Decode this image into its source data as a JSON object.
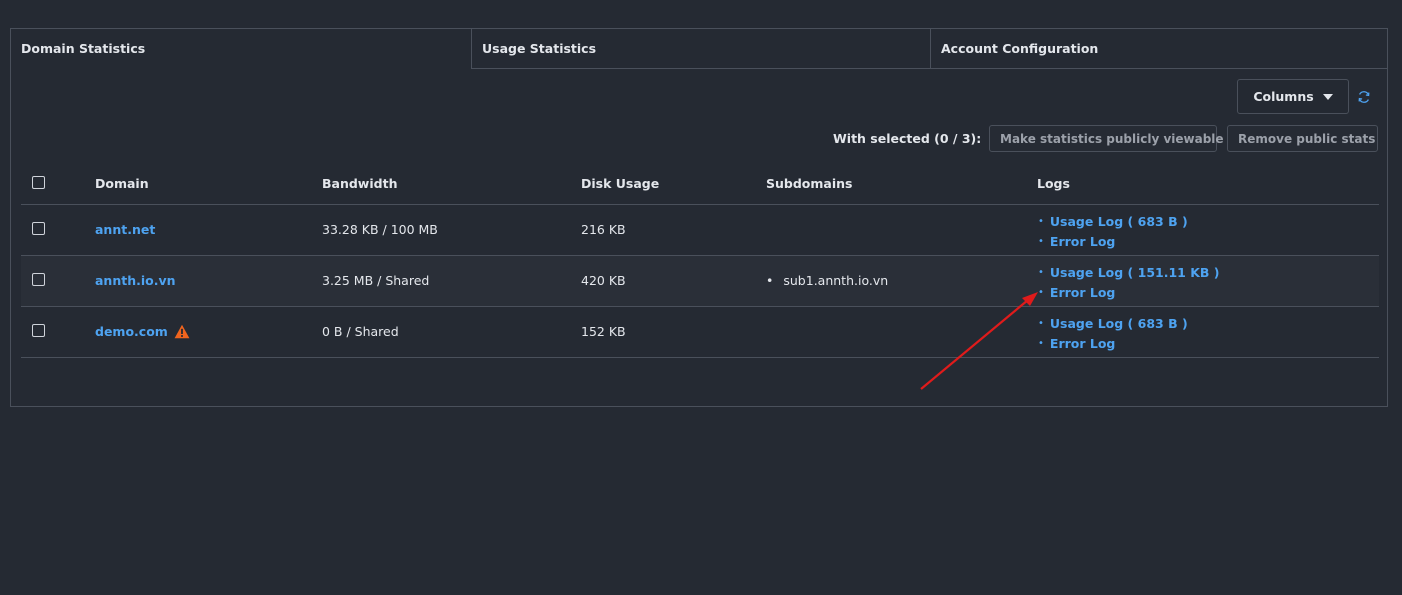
{
  "tabs": [
    {
      "label": "Domain Statistics",
      "active": true
    },
    {
      "label": "Usage Statistics",
      "active": false
    },
    {
      "label": "Account Configuration",
      "active": false
    }
  ],
  "toolbar": {
    "columns_label": "Columns",
    "with_selected": "With selected (0 / 3):",
    "make_public_label": "Make statistics publicly viewable",
    "remove_public_label": "Remove public stats",
    "refresh_icon": "refresh-icon"
  },
  "table": {
    "headers": {
      "domain": "Domain",
      "bandwidth": "Bandwidth",
      "disk": "Disk Usage",
      "subdomains": "Subdomains",
      "logs": "Logs"
    },
    "rows": [
      {
        "domain": "annt.net",
        "bandwidth": "33.28 KB / 100 MB",
        "disk": "216 KB",
        "subdomain": "",
        "usage_log": "Usage Log ( 683 B )",
        "error_log": "Error Log"
      },
      {
        "domain": "annth.io.vn",
        "bandwidth": "3.25 MB / Shared",
        "disk": "420 KB",
        "subdomain": "sub1.annth.io.vn",
        "usage_log": "Usage Log ( 151.11 KB )",
        "error_log": "Error Log"
      },
      {
        "domain": "demo.com",
        "bandwidth": "0 B / Shared",
        "disk": "152 KB",
        "subdomain": "",
        "usage_log": "Usage Log ( 683 B )",
        "error_log": "Error Log",
        "warning_icon": "warning-icon"
      }
    ]
  },
  "colors": {
    "background": "#252a33",
    "link": "#4ea3f1",
    "warning": "#f0641e",
    "annotation_arrow": "#e01b1b"
  }
}
